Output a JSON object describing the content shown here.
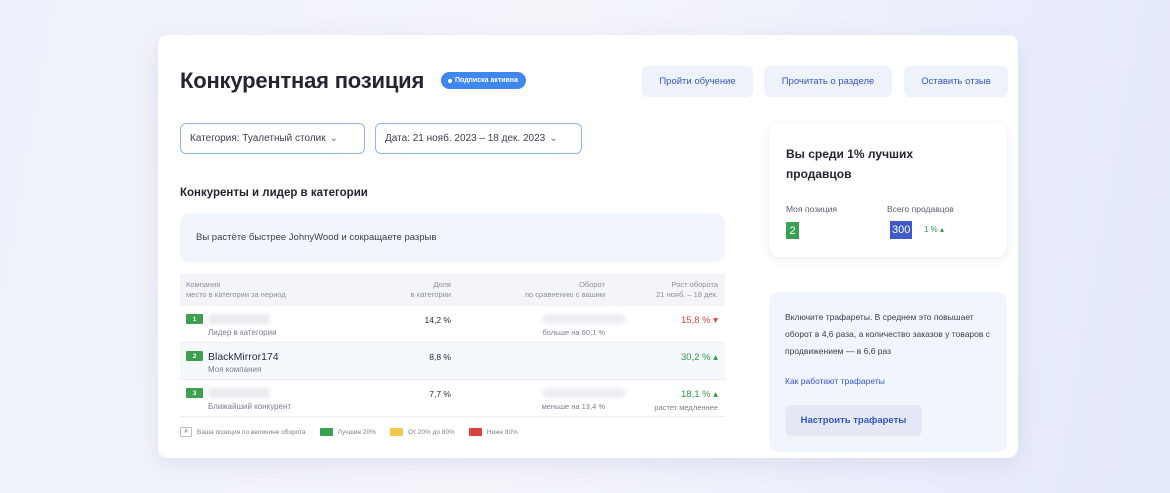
{
  "header": {
    "title": "Конкурентная позиция",
    "badge": "Подписка активна",
    "buttons": [
      "Пройти обучение",
      "Прочитать о разделе",
      "Оставить отзыв"
    ]
  },
  "filters": {
    "category": "Категория: Туалетный столик",
    "date": "Дата: 21 нояб. 2023 – 18 дек. 2023"
  },
  "competitors": {
    "title": "Конкуренты и лидер в категории",
    "info": "Вы растёте быстрее JohnyWood и сокращаете разрыв",
    "columns": [
      {
        "title": "Компания",
        "sub": "место в категории за период"
      },
      {
        "title": "Доля",
        "sub": "в категории"
      },
      {
        "title": "Оборот",
        "sub": "по сравнению с вашим"
      },
      {
        "title": "Рост оборота",
        "sub": "21 нояб. – 18 дек."
      }
    ],
    "rows": [
      {
        "rank": "1",
        "name": "",
        "role": "Лидер в категории",
        "share": "14,2 %",
        "turnover_note": "больше на 60,1 %",
        "growth": "15,8 % ▾",
        "growth_note": ""
      },
      {
        "rank": "2",
        "name": "BlackMirror174",
        "role": "Моя компания",
        "share": "8,8 %",
        "turnover_note": "",
        "growth": "30,2 % ▴",
        "growth_note": ""
      },
      {
        "rank": "3",
        "name": "",
        "role": "Ближайший конкурент",
        "share": "7,7 %",
        "turnover_note": "меньше на 13,4 %",
        "growth": "18,1 % ▴",
        "growth_note": "растет медленнее"
      }
    ],
    "legend": [
      "Ваша позиция по величине оборота",
      "Лучшие 20%",
      "От 20% до 80%",
      "Ниже 80%"
    ],
    "legend_box": "#",
    "legend_colors": [
      "#3ba150",
      "#f2c94c",
      "#d9433f"
    ]
  },
  "position": {
    "title": "Вы среди 1% лучших продавцов",
    "my_position_label": "Моя позиция",
    "total_label": "Всего продавцов",
    "my_position": "2",
    "total": "300",
    "percent": "1 % ▴"
  },
  "promo": {
    "text": "Включите трафареты. В среднем это повышает оборот в 4,6 раза, а количество заказов у товаров с продвижением — в 6,6 раз",
    "link": "Как работают трафареты",
    "button": "Настроить трафареты"
  }
}
